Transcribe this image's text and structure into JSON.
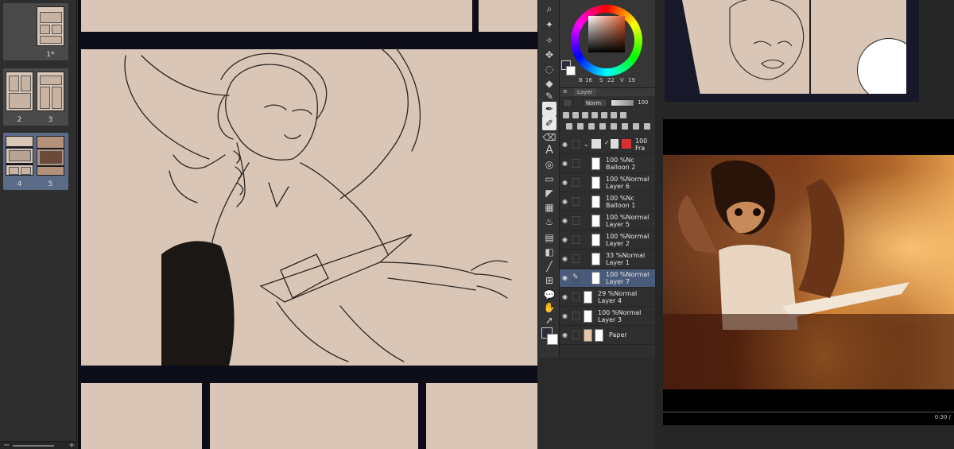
{
  "pages": [
    {
      "label": "1*",
      "selected": false
    },
    {
      "label": "2",
      "selected": false
    },
    {
      "label": "3",
      "selected": false
    },
    {
      "label": "4",
      "selected": true
    },
    {
      "label": "5",
      "selected": true
    }
  ],
  "color_panel": {
    "values": [
      "16",
      "22",
      "19"
    ],
    "labels": [
      "B",
      "S",
      "V"
    ],
    "accent": "#e05a2a"
  },
  "layer_panel": {
    "tab_label": "Layer",
    "blend_mode": "Norm",
    "opacity": "100",
    "folder": {
      "opacity": "100",
      "name": "Fra"
    },
    "layers": [
      {
        "opacity": "100 %Nc",
        "name": "Balloon 2",
        "kind": "balloon"
      },
      {
        "opacity": "100 %Normal",
        "name": "Layer 6",
        "kind": "raster"
      },
      {
        "opacity": "100 %Nc",
        "name": "Balloon 1",
        "kind": "balloon"
      },
      {
        "opacity": "100 %Normal",
        "name": "Layer 5",
        "kind": "raster"
      },
      {
        "opacity": "100 %Normal",
        "name": "Layer 2",
        "kind": "raster"
      },
      {
        "opacity": "33 %Normal",
        "name": "Layer 1",
        "kind": "raster"
      },
      {
        "opacity": "100 %Normal",
        "name": "Layer 7",
        "kind": "raster",
        "selected": true
      },
      {
        "opacity": "29 %Normal",
        "name": "Layer 4",
        "kind": "raster"
      },
      {
        "opacity": "100 %Normal",
        "name": "Layer 3",
        "kind": "raster"
      },
      {
        "opacity": "",
        "name": "Paper",
        "kind": "paper"
      }
    ]
  },
  "video": {
    "timecode": "0:30 /"
  },
  "colors": {
    "panel_border": "#0d0d1a",
    "paper": "#d9c6b7",
    "selection": "#4a5a7a"
  }
}
